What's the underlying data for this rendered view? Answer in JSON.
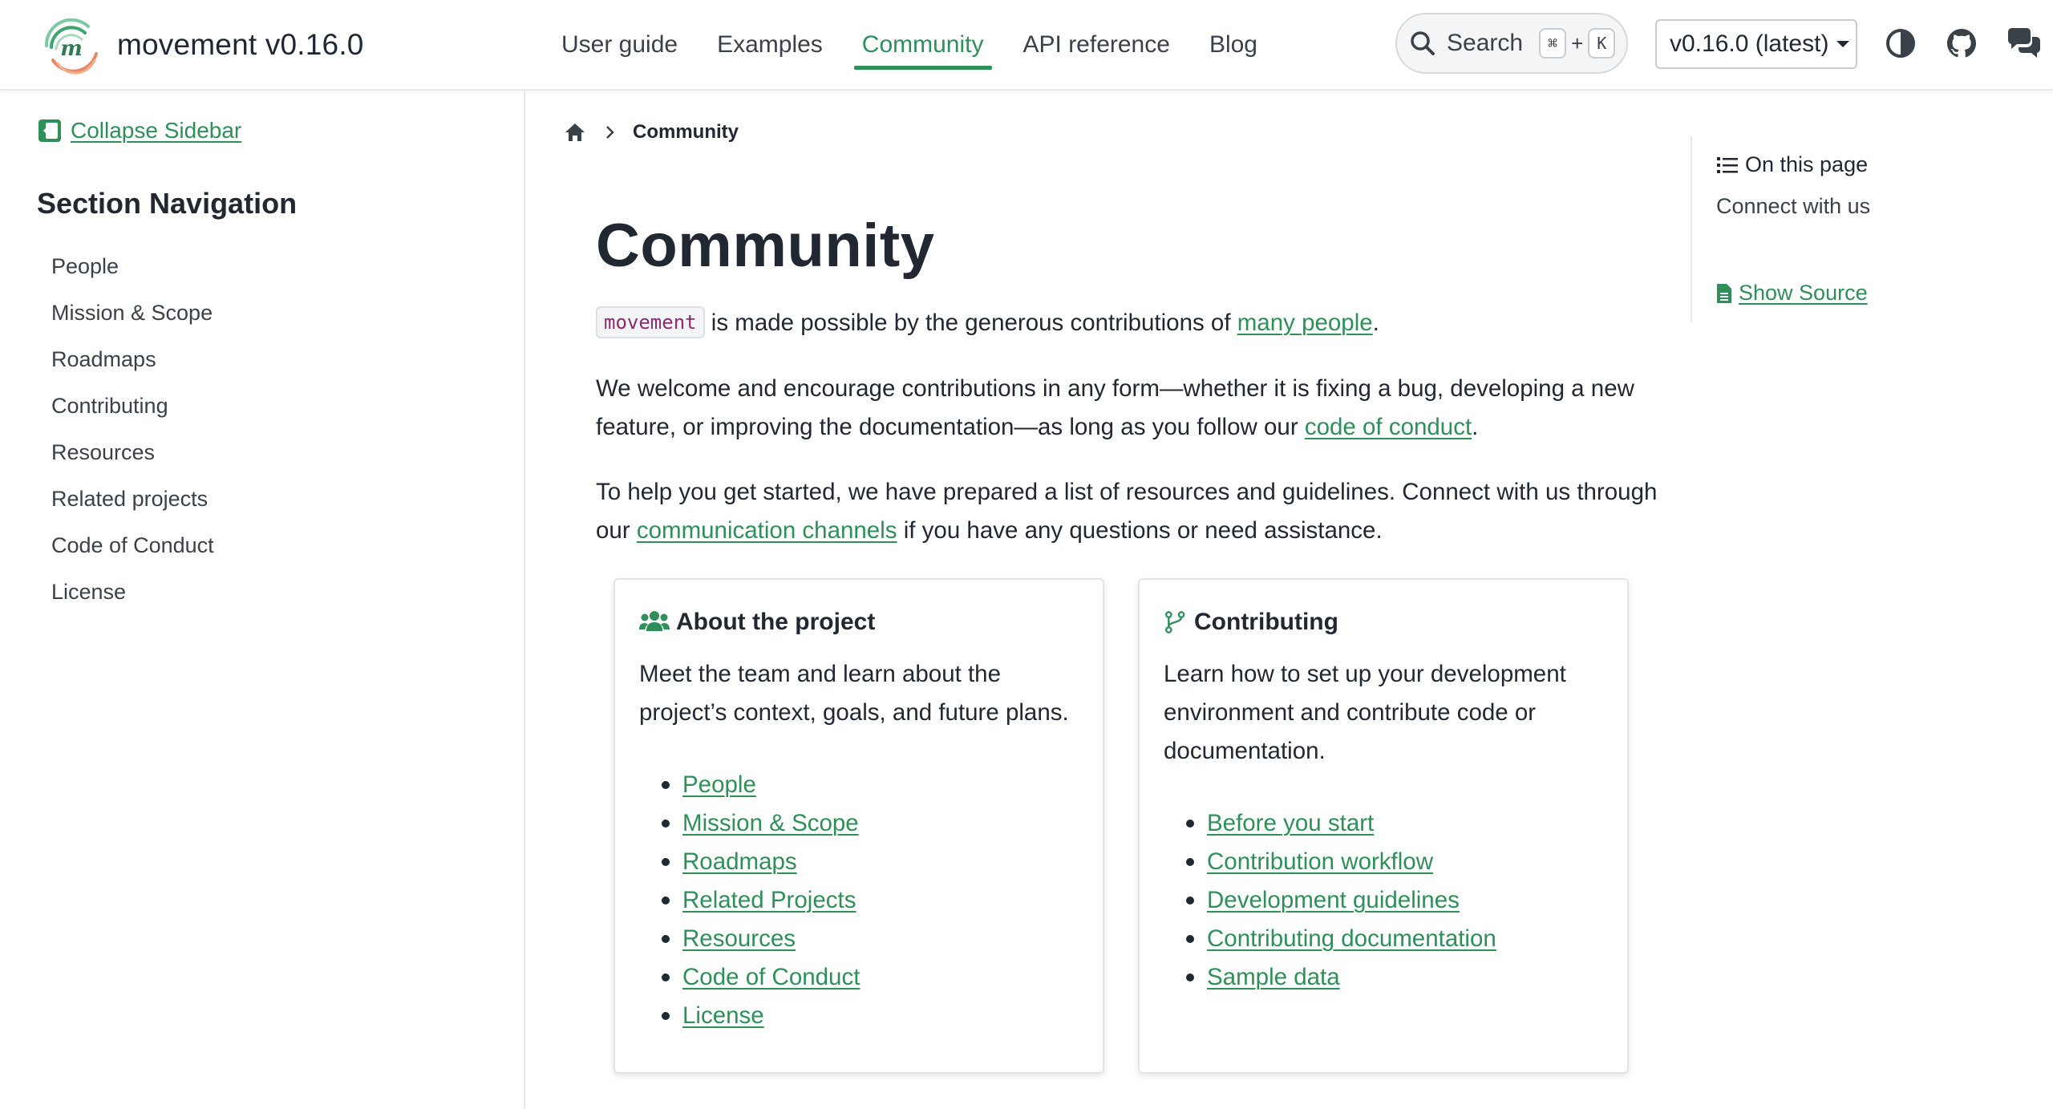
{
  "header": {
    "brand_title": "movement v0.16.0",
    "logo_letter": "m",
    "nav": [
      {
        "label": "User guide",
        "active": false
      },
      {
        "label": "Examples",
        "active": false
      },
      {
        "label": "Community",
        "active": true
      },
      {
        "label": "API reference",
        "active": false
      },
      {
        "label": "Blog",
        "active": false
      }
    ],
    "search_label": "Search",
    "search_keys": [
      "⌘",
      "+",
      "K"
    ],
    "version_label": "v0.16.0 (latest)",
    "icons": [
      "theme-toggle-icon",
      "github-icon",
      "chat-icon"
    ]
  },
  "sidebar": {
    "collapse_label": "Collapse Sidebar",
    "section_title": "Section Navigation",
    "items": [
      "People",
      "Mission & Scope",
      "Roadmaps",
      "Contributing",
      "Resources",
      "Related projects",
      "Code of Conduct",
      "License"
    ]
  },
  "breadcrumb": {
    "current": "Community"
  },
  "main": {
    "title": "Community",
    "p1_code": "movement",
    "p1_text": " is made possible by the generous contributions of ",
    "p1_link": "many people",
    "p1_end": ".",
    "p2_text": "We welcome and encourage contributions in any form—whether it is fixing a bug, developing a new feature, or improving the documentation—as long as you follow our ",
    "p2_link": "code of conduct",
    "p2_end": ".",
    "p3_text": "To help you get started, we have prepared a list of resources and guidelines. Connect with us through our ",
    "p3_link": "communication channels",
    "p3_end": " if you have any questions or need assistance."
  },
  "cards": [
    {
      "title": "About the project",
      "icon": "users-icon",
      "description": "Meet the team and learn about the project’s context, goals, and future plans.",
      "links": [
        "People",
        "Mission & Scope",
        "Roadmaps",
        "Related Projects",
        "Resources",
        "Code of Conduct",
        "License"
      ]
    },
    {
      "title": "Contributing",
      "icon": "code-branch-icon",
      "description": "Learn how to set up your development environment and contribute code or documentation.",
      "links": [
        "Before you start",
        "Contribution workflow",
        "Development guidelines",
        "Contributing documentation",
        "Sample data"
      ]
    }
  ],
  "toc": {
    "heading": "On this page",
    "links": [
      "Connect with us"
    ],
    "show_source": "Show Source"
  },
  "colors": {
    "accent": "#2f8f59",
    "text": "#222832",
    "muted": "#3b4149",
    "border": "#e6e8eb",
    "code": "#8a2d6e"
  }
}
